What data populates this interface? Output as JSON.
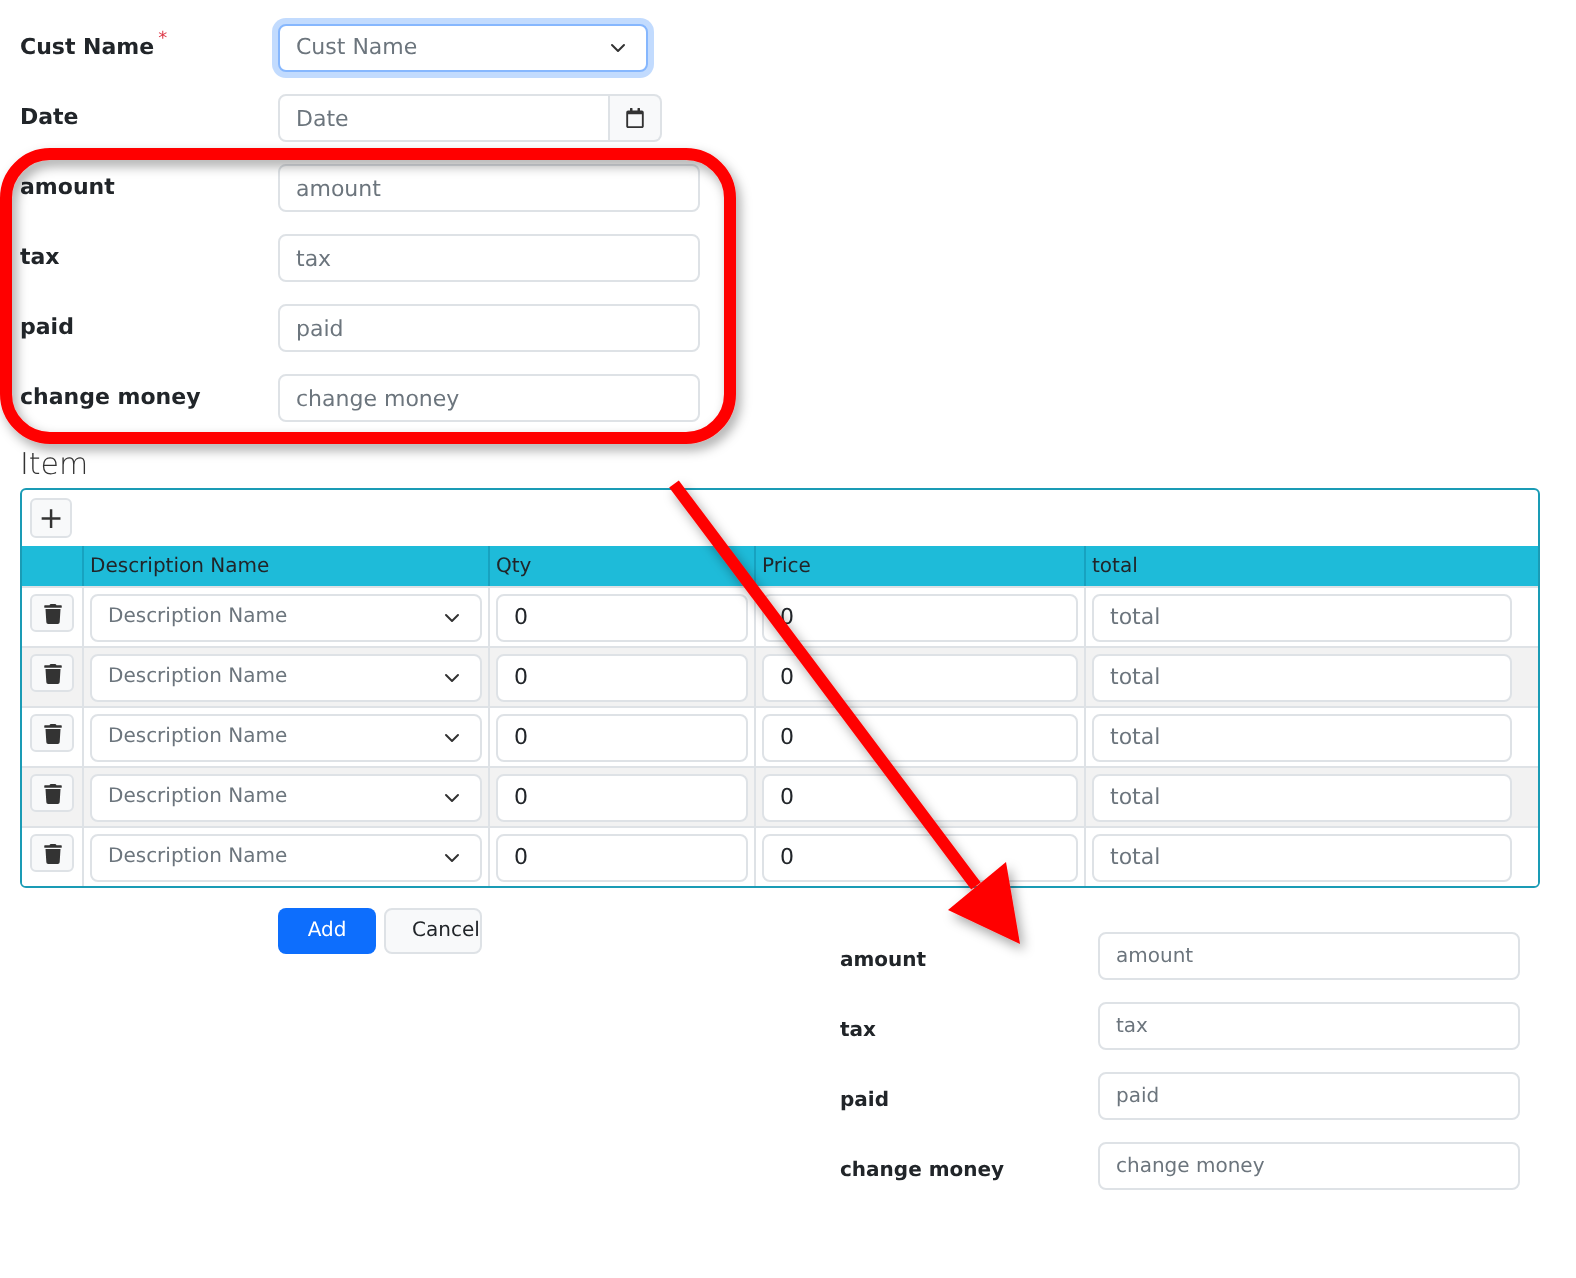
{
  "form": {
    "fields": [
      {
        "label": "Cust Name",
        "required_mark": "*",
        "kind": "select",
        "placeholder": "Cust Name",
        "focused": true
      },
      {
        "label": "Date",
        "kind": "date",
        "placeholder": "Date",
        "focused": false
      },
      {
        "label": "amount",
        "kind": "text",
        "placeholder": "amount",
        "focused": false
      },
      {
        "label": "tax",
        "kind": "text",
        "placeholder": "tax",
        "focused": false
      },
      {
        "label": "paid",
        "kind": "text",
        "placeholder": "paid",
        "focused": false
      },
      {
        "label": "change money",
        "kind": "text",
        "placeholder": "change money",
        "focused": false
      }
    ]
  },
  "items": {
    "title": "Item",
    "add_row_button": "+",
    "columns": [
      "Description Name",
      "Qty",
      "Price",
      "total"
    ],
    "rows": [
      {
        "description_placeholder": "Description Name",
        "qty": "0",
        "price": "0",
        "total_placeholder": "total"
      },
      {
        "description_placeholder": "Description Name",
        "qty": "0",
        "price": "0",
        "total_placeholder": "total"
      },
      {
        "description_placeholder": "Description Name",
        "qty": "0",
        "price": "0",
        "total_placeholder": "total"
      },
      {
        "description_placeholder": "Description Name",
        "qty": "0",
        "price": "0",
        "total_placeholder": "total"
      },
      {
        "description_placeholder": "Description Name",
        "qty": "0",
        "price": "0",
        "total_placeholder": "total"
      }
    ]
  },
  "buttons": [
    {
      "label": "Add",
      "kind": "primary"
    },
    {
      "label": "Cancel",
      "kind": "secondary"
    }
  ],
  "summary": {
    "fields": [
      {
        "label": "amount",
        "placeholder": "amount"
      },
      {
        "label": "tax",
        "placeholder": "tax"
      },
      {
        "label": "paid",
        "placeholder": "paid"
      },
      {
        "label": "change money",
        "placeholder": "change money"
      }
    ]
  }
}
